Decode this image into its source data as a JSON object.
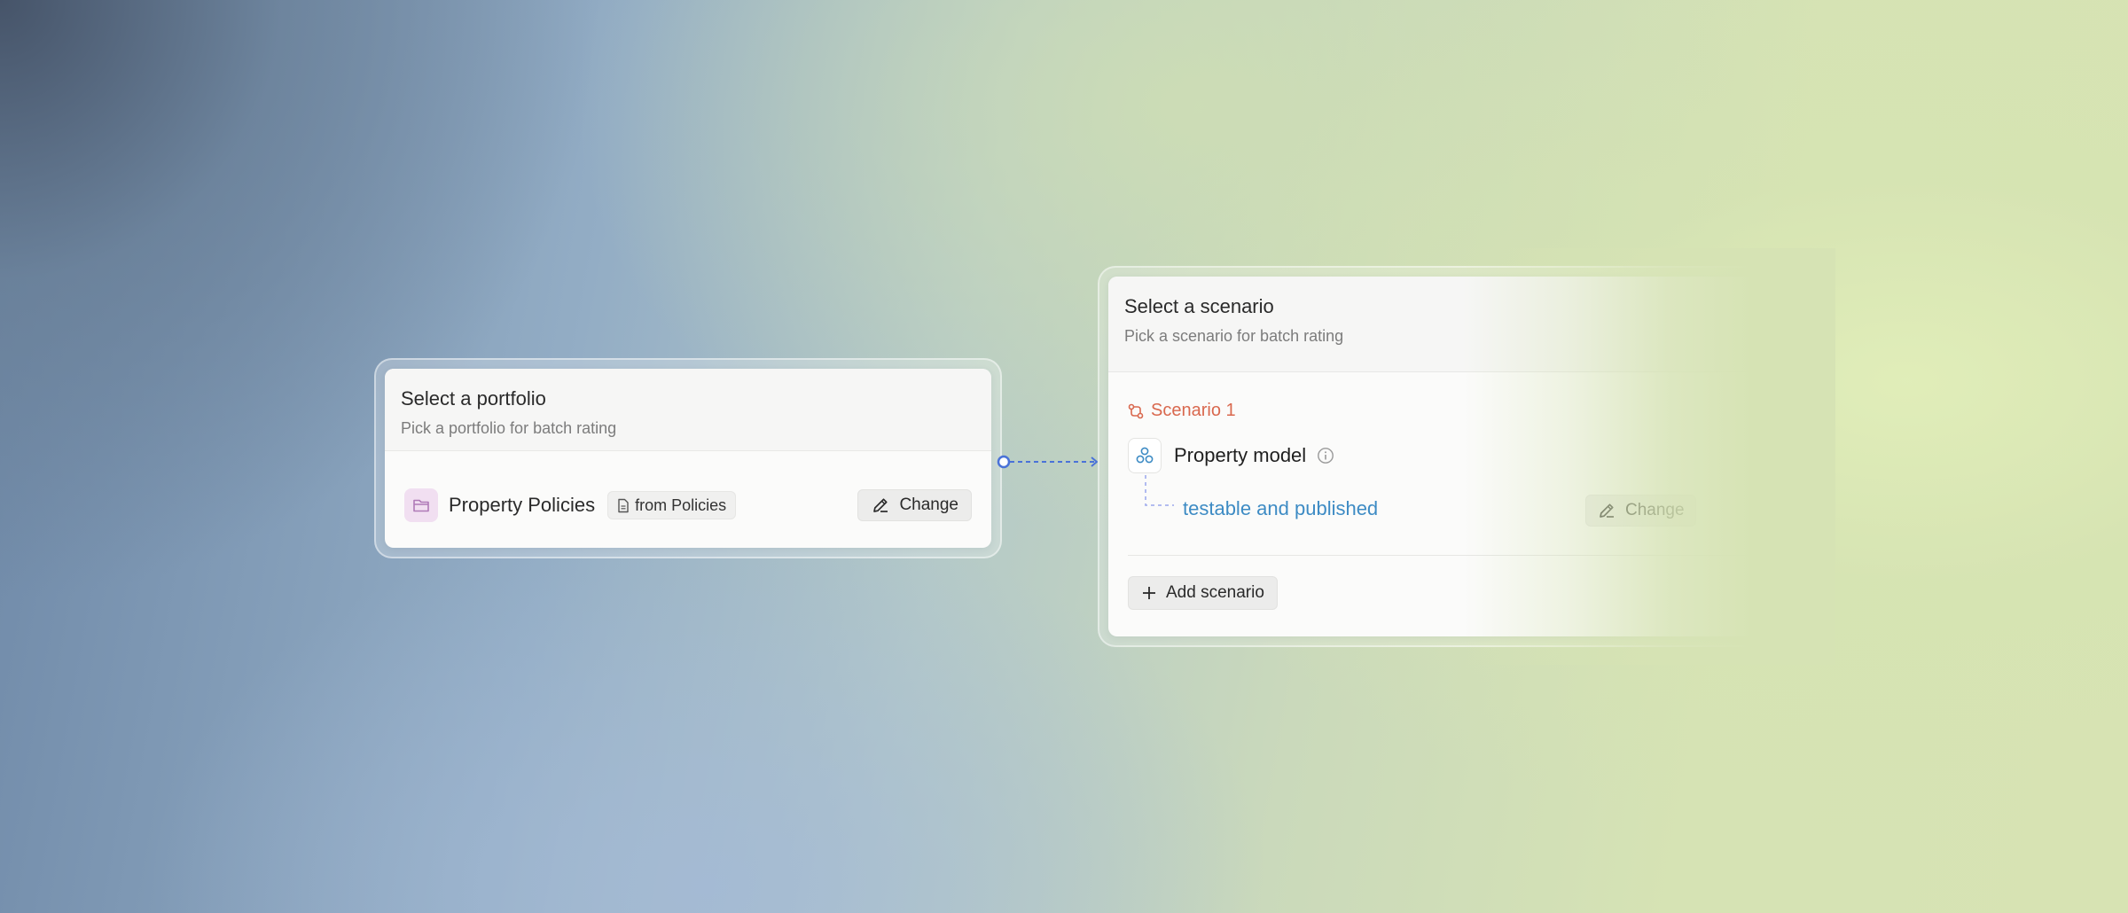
{
  "portfolio_card": {
    "title": "Select a portfolio",
    "subtitle": "Pick a portfolio for batch rating",
    "selected_portfolio": "Property Policies",
    "source_chip": "from Policies",
    "change_label": "Change"
  },
  "scenario_card": {
    "title": "Select a scenario",
    "subtitle": "Pick a scenario for batch rating",
    "scenario_label": "Scenario 1",
    "model_name": "Property model",
    "model_status": "testable and published",
    "change_label": "Change",
    "add_label": "Add scenario"
  },
  "colors": {
    "scenario_accent": "#d9684e",
    "status_link": "#3d8bc4",
    "connector": "#4a72d8",
    "folder_tile": "#f1dff1"
  },
  "icons": [
    "folder-icon",
    "document-icon",
    "pencil-icon",
    "scenario-icon",
    "model-icon",
    "info-icon",
    "plus-icon"
  ]
}
